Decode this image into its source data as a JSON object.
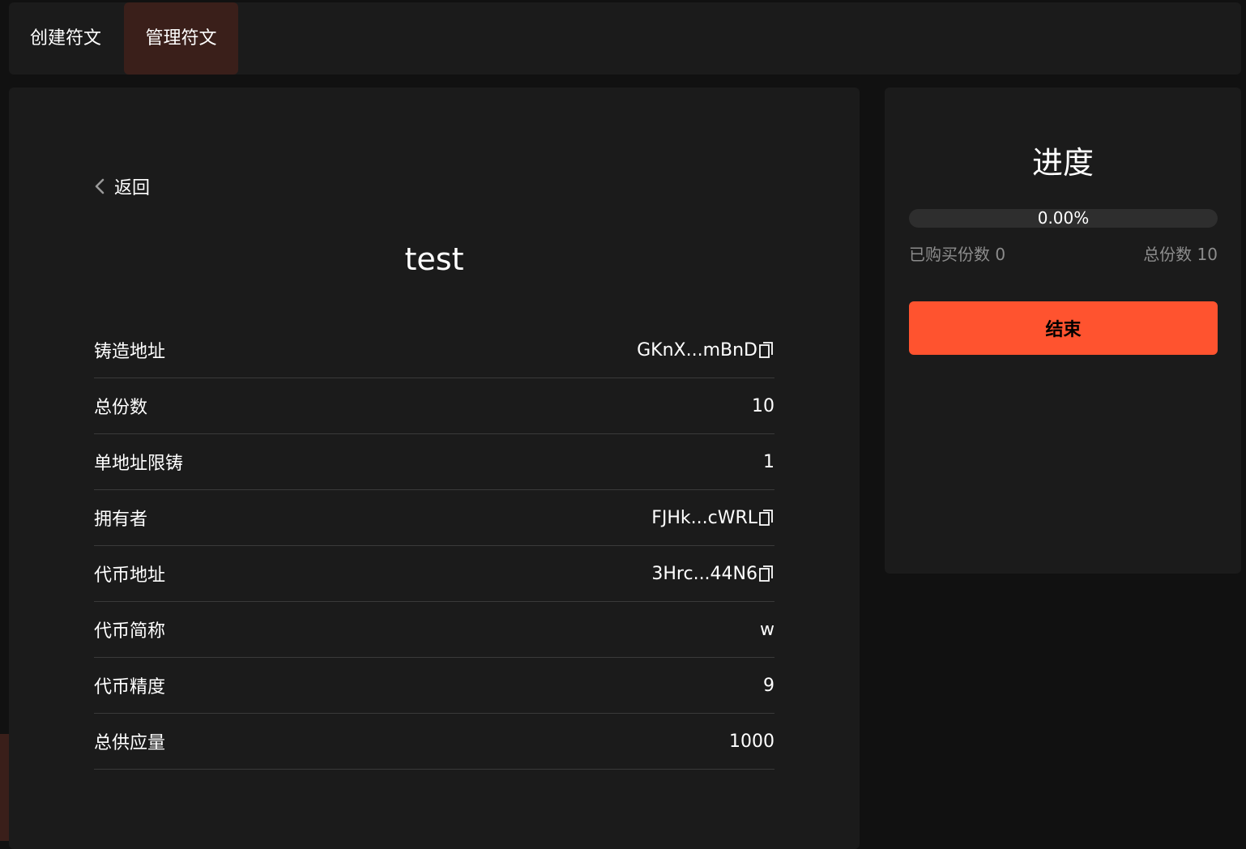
{
  "tabs": [
    {
      "label": "创建符文",
      "active": false
    },
    {
      "label": "管理符文",
      "active": true
    }
  ],
  "detail": {
    "back_label": "返回",
    "token_name": "test",
    "rows": [
      {
        "label": "铸造地址",
        "value": "GKnX...mBnD",
        "copyable": true
      },
      {
        "label": "总份数",
        "value": "10",
        "copyable": false
      },
      {
        "label": "单地址限铸",
        "value": "1",
        "copyable": false
      },
      {
        "label": "拥有者",
        "value": "FJHk...cWRL",
        "copyable": true
      },
      {
        "label": "代币地址",
        "value": "3Hrc...44N6",
        "copyable": true
      },
      {
        "label": "代币简称",
        "value": "w",
        "copyable": false
      },
      {
        "label": "代币精度",
        "value": "9",
        "copyable": false
      },
      {
        "label": "总供应量",
        "value": "1000",
        "copyable": false
      }
    ]
  },
  "progress": {
    "title": "进度",
    "percent_text": "0.00%",
    "fraction": 0,
    "purchased_text": "已购买份数 0",
    "total_text": "总份数 10",
    "end_button_label": "结束"
  },
  "colors": {
    "accent": "#ff532f",
    "active_tab": "#3a1f1a",
    "card": "#1b1b1b",
    "background": "#111111"
  }
}
